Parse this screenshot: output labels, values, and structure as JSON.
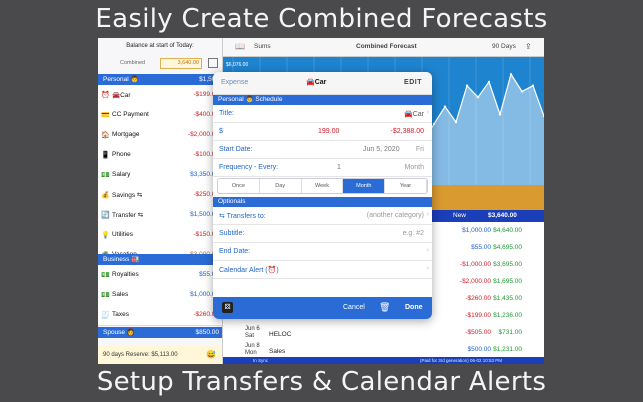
{
  "headline_top": "Easily Create Combined Forecasts",
  "headline_bottom": "Setup Transfers & Calendar Alerts",
  "left": {
    "balance_title": "Balance at start of Today:",
    "combined_label": "Combined",
    "combined_value": "3,640.00",
    "sections": [
      {
        "name": "Personal 👨",
        "amount": "$1,500"
      },
      {
        "name": "Business 🏭",
        "amount": ""
      },
      {
        "name": "Spouse 👩",
        "amount": "$850.00"
      }
    ],
    "personal_items": [
      {
        "icon": "⏰",
        "name": "🚘Car",
        "amount": "-$199.00",
        "color": "red"
      },
      {
        "icon": "💳",
        "name": "CC Payment",
        "amount": "-$400.00",
        "color": "red"
      },
      {
        "icon": "🏠",
        "name": "Mortgage",
        "amount": "-$2,000.00",
        "color": "red"
      },
      {
        "icon": "📱",
        "name": "Phone",
        "amount": "-$100.00",
        "color": "red"
      },
      {
        "icon": "💵",
        "name": "Salary",
        "amount": "$3,350.00",
        "color": "blu"
      },
      {
        "icon": "💰",
        "name": "Savings ⇆",
        "amount": "-$250.00",
        "color": "red"
      },
      {
        "icon": "🔄",
        "name": "Transfer ⇆",
        "amount": "$1,500.00",
        "color": "blu"
      },
      {
        "icon": "💡",
        "name": "Utilities",
        "amount": "-$150.00",
        "color": "red"
      },
      {
        "icon": "🌴",
        "name": "Vacation",
        "amount": "-$3,000.00",
        "color": "org"
      }
    ],
    "business_items": [
      {
        "icon": "💵",
        "name": "Royalties",
        "amount": "$55.00",
        "color": "blu"
      },
      {
        "icon": "💵",
        "name": "Sales",
        "amount": "$1,000.00",
        "color": "blu"
      },
      {
        "icon": "🧾",
        "name": "Taxes",
        "amount": "-$260.00",
        "color": "red"
      }
    ],
    "reserve_text": "90 days Reserve: $5,113.00",
    "reserve_emoji": "😅"
  },
  "right": {
    "sums_label": "Sums",
    "title": "Combined Forecast",
    "days_label": "90 Days",
    "new_label": "New",
    "new_total": "$3,640.00",
    "rows": [
      {
        "date": "",
        "name": "",
        "amount": "$1,000.00",
        "balance": "$4,640.00"
      },
      {
        "date": "",
        "name": "",
        "amount": "$55.00",
        "balance": "$4,695.00"
      },
      {
        "date": "",
        "name": "",
        "amount": "-$1,000.00",
        "balance": "$3,695.00"
      },
      {
        "date": "",
        "name": "",
        "amount": "-$2,000.00",
        "balance": "$1,695.00"
      },
      {
        "date": "",
        "name": "",
        "amount": "-$260.00",
        "balance": "$1,435.00"
      },
      {
        "date": "",
        "name": "",
        "amount": "-$199.00",
        "balance": "$1,236.00"
      },
      {
        "date": "Jun 6\nSat",
        "name": "HELOC",
        "amount": "-$505.00",
        "balance": "$731.00"
      },
      {
        "date": "Jun 8\nMon",
        "name": "Sales",
        "amount": "$500.00",
        "balance": "$1,231.00"
      }
    ],
    "status_left": "In Sync",
    "status_right": "(Paid for 3rd generation)  06-02 10:53 PM"
  },
  "modal": {
    "left": "Expense",
    "title": "🚘Car",
    "edit": "EDIT",
    "section": "Personal 👨 Schedule",
    "title_label": "Title:",
    "title_value": "🚘Car",
    "amount_label": "$",
    "amount_value": "199.00",
    "amount_neg": "-$2,388.00",
    "start_label": "Start Date:",
    "start_value": "Jun 5, 2020",
    "start_day": "Fri",
    "freq_label": "Frequency - Every:",
    "freq_num": "1",
    "freq_unit": "Month",
    "segments": [
      "Once",
      "Day",
      "Week",
      "Month",
      "Year"
    ],
    "selected_segment": "Month",
    "optionals": "Optionals",
    "transfers_label": "⇆ Transfers to:",
    "transfers_value": "(another category)",
    "subtitle_label": "Subtitle:",
    "subtitle_placeholder": "e.g. #2",
    "end_label": "End Date:",
    "alert_label": "Calendar Alert (⏰)",
    "cancel": "Cancel",
    "done": "Done"
  },
  "chart_data": {
    "type": "area",
    "ylabel_top": "$6,076.00",
    "values": [
      2200,
      3200,
      4100,
      3300,
      5200,
      4600,
      5400,
      3700,
      5800,
      4900,
      5200,
      3600
    ],
    "ylim": [
      0,
      6076
    ]
  }
}
